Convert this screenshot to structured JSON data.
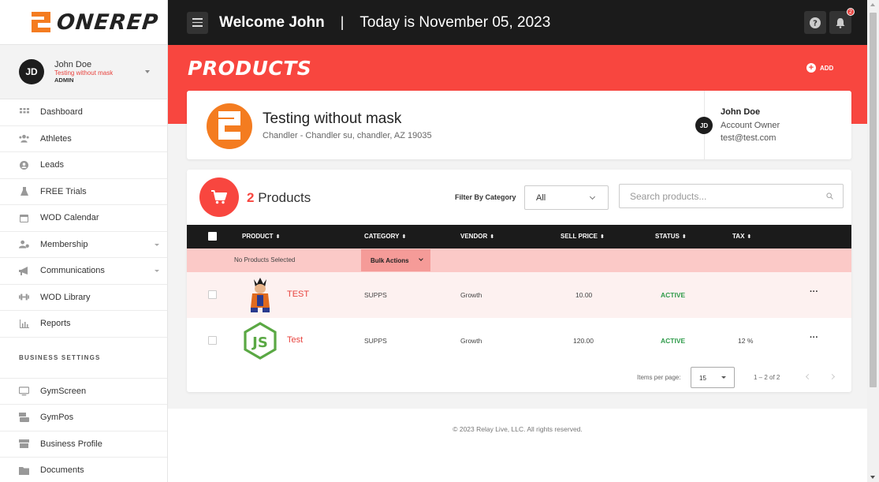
{
  "brand": {
    "name": "ONEREP",
    "accent": "#f8463f",
    "logo_orange": "#f47c20"
  },
  "user": {
    "initials": "JD",
    "name": "John Doe",
    "gym": "Testing without mask",
    "role": "ADMIN"
  },
  "sidebar": {
    "items": [
      {
        "label": "Dashboard",
        "icon": "dashboard-icon"
      },
      {
        "label": "Athletes",
        "icon": "athletes-icon"
      },
      {
        "label": "Leads",
        "icon": "leads-icon"
      },
      {
        "label": "FREE Trials",
        "icon": "flask-icon"
      },
      {
        "label": "WOD Calendar",
        "icon": "calendar-icon"
      },
      {
        "label": "Membership",
        "icon": "membership-icon"
      },
      {
        "label": "Communications",
        "icon": "megaphone-icon"
      },
      {
        "label": "WOD Library",
        "icon": "dumbbell-icon"
      },
      {
        "label": "Reports",
        "icon": "reports-icon"
      }
    ],
    "section_title": "BUSINESS SETTINGS",
    "settings_items": [
      {
        "label": "GymScreen",
        "icon": "monitor-icon"
      },
      {
        "label": "GymPos",
        "icon": "pos-icon"
      },
      {
        "label": "Business Profile",
        "icon": "store-icon"
      },
      {
        "label": "Documents",
        "icon": "documents-icon"
      }
    ]
  },
  "header": {
    "welcome": "Welcome John",
    "separator": "|",
    "today": "Today is November 05, 2023",
    "notification_count": "2"
  },
  "page": {
    "title": "PRODUCTS",
    "add_label": "ADD"
  },
  "gym_card": {
    "name": "Testing without mask",
    "address": "Chandler - Chandler su, chandler, AZ 19035",
    "owner_initials": "JD",
    "owner_name": "John Doe",
    "owner_role": "Account Owner",
    "owner_email": "test@test.com"
  },
  "products": {
    "count": "2",
    "count_label": " Products",
    "filter_label": "Filter By Category",
    "filter_value": "All",
    "search_placeholder": "Search products...",
    "columns": [
      "PRODUCT",
      "CATEGORY",
      "VENDOR",
      "SELL PRICE",
      "STATUS",
      "TAX"
    ],
    "no_selection": "No Products Selected",
    "bulk_actions": "Bulk Actions",
    "rows": [
      {
        "name": "TEST",
        "category": "SUPPS",
        "vendor": "Growth",
        "price": "10.00",
        "status": "ACTIVE",
        "tax": "",
        "more": "···"
      },
      {
        "name": "Test",
        "category": "SUPPS",
        "vendor": "Growth",
        "price": "120.00",
        "status": "ACTIVE",
        "tax": "12 %",
        "more": "···"
      }
    ],
    "pager": {
      "label": "Items per page:",
      "per_page": "15",
      "range": "1 – 2 of 2"
    }
  },
  "footer": {
    "copyright": "© 2023 Relay Live, LLC. All rights reserved."
  }
}
